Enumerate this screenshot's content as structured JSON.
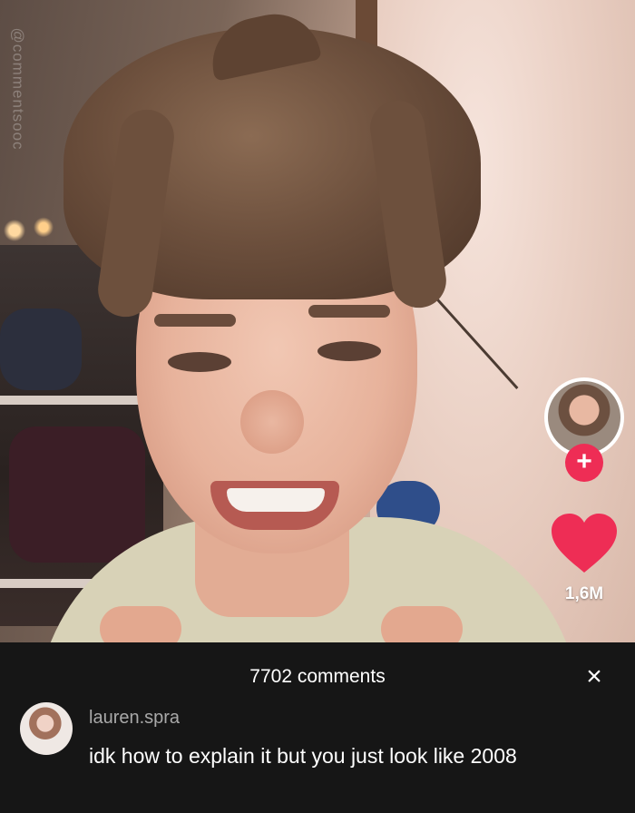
{
  "video": {
    "watermark": "@commentsooc"
  },
  "actions": {
    "follow_plus": "+",
    "like_count": "1,6M",
    "heart_color": "#ee2d55"
  },
  "comments_panel": {
    "count_label": "7702 comments",
    "close_icon": "×",
    "comments": [
      {
        "username": "lauren.spra",
        "text": "idk how to explain it but you just look like 2008"
      }
    ]
  }
}
